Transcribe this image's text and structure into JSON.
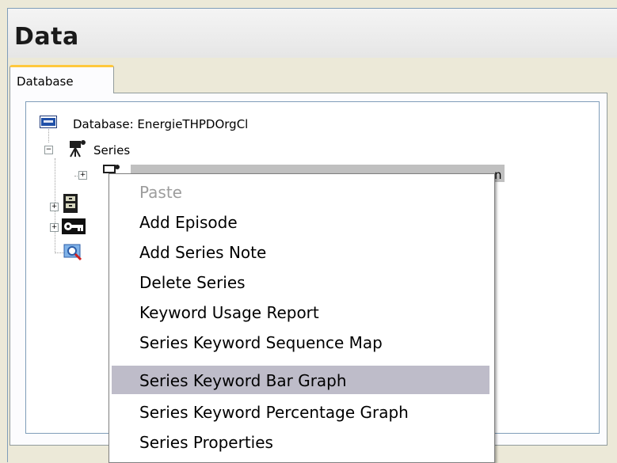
{
  "window": {
    "title": "Data"
  },
  "tabs": [
    {
      "label": "Database"
    }
  ],
  "tree": {
    "root": {
      "label": "Database: EnergieTHPDOrgCl",
      "icon": "database-icon"
    },
    "series_node": {
      "label": "Series",
      "icon": "series-camera-icon"
    },
    "selected_node": {
      "label_tail": "n",
      "icon": "series-item-icon"
    },
    "other_nodes": [
      {
        "icon": "collection-cabinet-icon"
      },
      {
        "icon": "keyword-key-icon"
      },
      {
        "icon": "search-icon"
      }
    ]
  },
  "context_menu": {
    "items": [
      {
        "label": "Paste",
        "state": "disabled"
      },
      {
        "label": "Add Episode",
        "state": "normal"
      },
      {
        "label": "Add Series Note",
        "state": "normal"
      },
      {
        "label": "Delete Series",
        "state": "normal"
      },
      {
        "label": "Keyword Usage Report",
        "state": "normal"
      },
      {
        "label": "Series Keyword Sequence Map",
        "state": "normal"
      },
      {
        "label": "Series Keyword Bar Graph",
        "state": "highlighted"
      },
      {
        "label": "Series Keyword Percentage Graph",
        "state": "normal"
      },
      {
        "label": "Series Properties",
        "state": "normal"
      }
    ]
  },
  "colors": {
    "tab_accent": "#ffc83c",
    "menu_highlight": "#bebcc9",
    "disabled_text": "#9d9d9d"
  }
}
